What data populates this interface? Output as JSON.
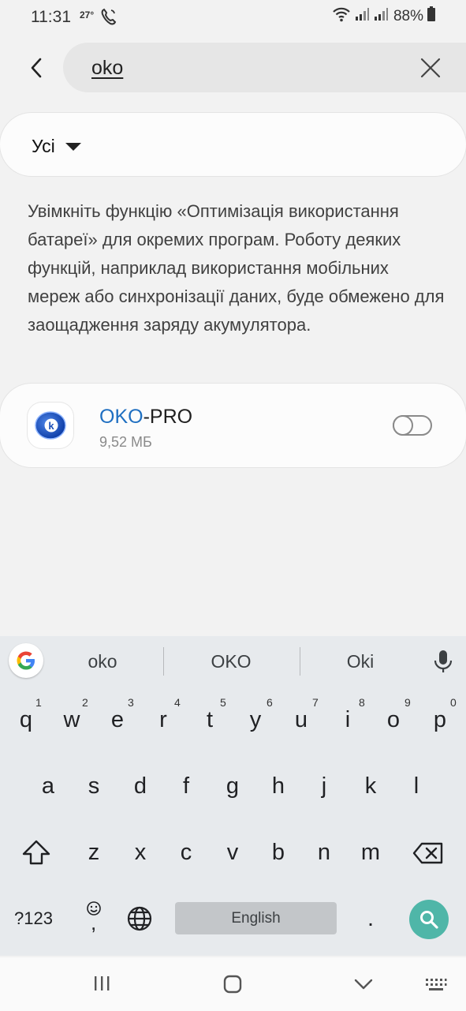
{
  "status_bar": {
    "time": "11:31",
    "temperature": "27°",
    "battery": "88%"
  },
  "search": {
    "query": "oko"
  },
  "filter": {
    "label": "Усі"
  },
  "description": "Увімкніть функцію «Оптимізація використання батареї» для окремих програм. Роботу деяких функцій, наприклад використання мобільних мереж або синхронізації даних, буде обмежено для заощадження заряду акумулятора.",
  "app": {
    "name_highlight": "OKO",
    "name_rest": "-PRO",
    "size": "9,52 МБ",
    "toggle_on": false
  },
  "keyboard": {
    "suggestions": [
      "oko",
      "OKO",
      "Oki"
    ],
    "row1": [
      "q",
      "w",
      "e",
      "r",
      "t",
      "y",
      "u",
      "i",
      "o",
      "p"
    ],
    "row1_hints": [
      "1",
      "2",
      "3",
      "4",
      "5",
      "6",
      "7",
      "8",
      "9",
      "0"
    ],
    "row2": [
      "a",
      "s",
      "d",
      "f",
      "g",
      "h",
      "j",
      "k",
      "l"
    ],
    "row3": [
      "z",
      "x",
      "c",
      "v",
      "b",
      "n",
      "m"
    ],
    "symbols_label": "?123",
    "emoji_comma": ",",
    "space_label": "English",
    "period": "."
  },
  "colors": {
    "accent": "#1f6fc1",
    "search_key": "#4fb6a8"
  }
}
